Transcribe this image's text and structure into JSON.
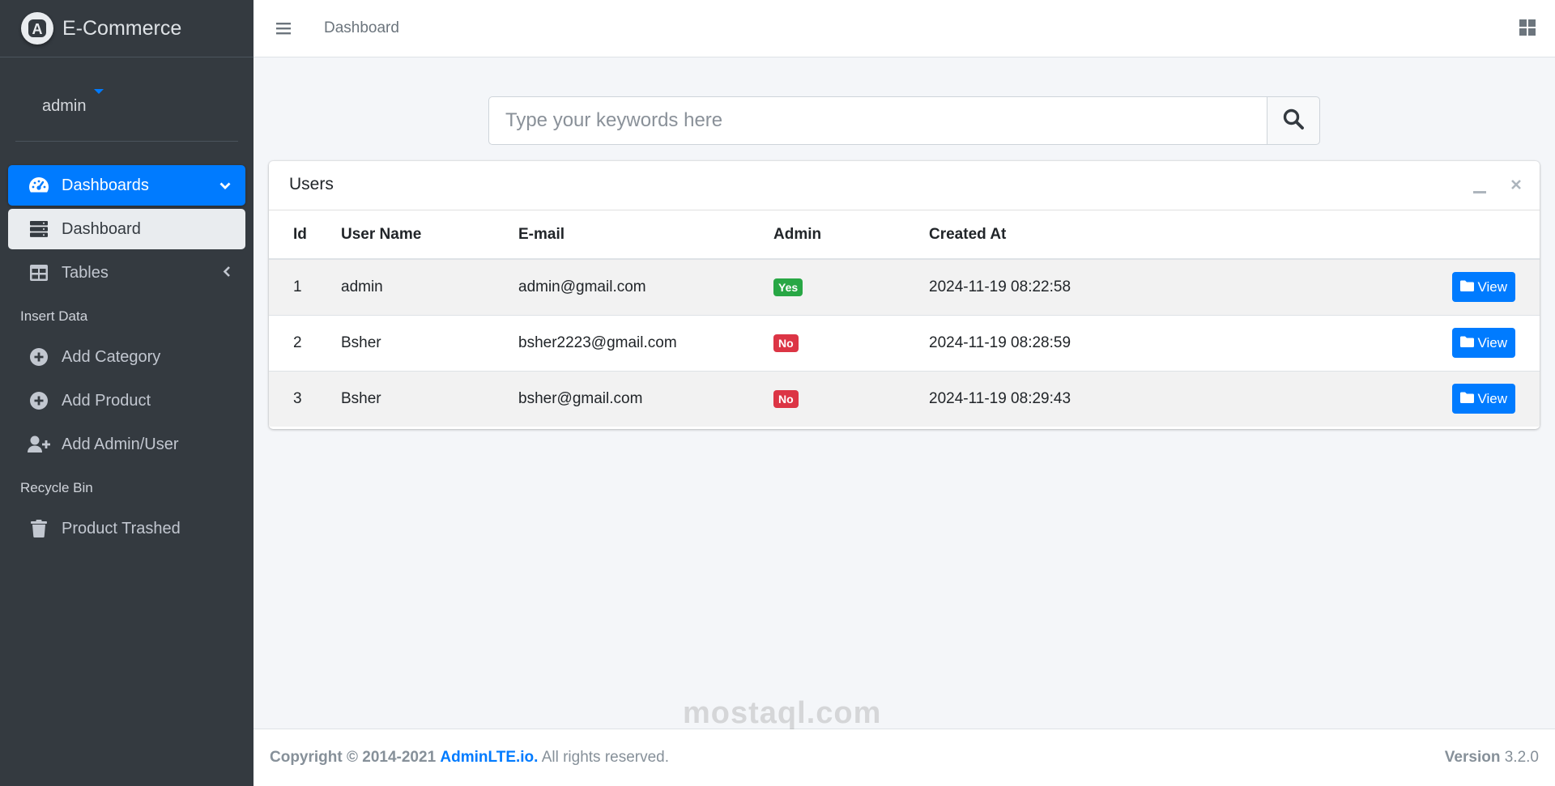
{
  "brand": {
    "name": "E-Commerce",
    "logo_letter": "A"
  },
  "user": {
    "name": "admin"
  },
  "sidebar": {
    "items": [
      {
        "label": "Dashboards",
        "icon": "tachometer-icon"
      },
      {
        "label": "Dashboard",
        "icon": "server-icon"
      },
      {
        "label": "Tables",
        "icon": "table-icon"
      }
    ],
    "header_insert": "Insert Data",
    "insert_items": [
      {
        "label": "Add Category",
        "icon": "plus-circle-icon"
      },
      {
        "label": "Add Product",
        "icon": "plus-circle-icon"
      },
      {
        "label": "Add Admin/User",
        "icon": "user-plus-icon"
      }
    ],
    "header_recycle": "Recycle Bin",
    "recycle_items": [
      {
        "label": "Product Trashed",
        "icon": "trash-icon"
      }
    ]
  },
  "topbar": {
    "link": "Dashboard"
  },
  "search": {
    "placeholder": "Type your keywords here"
  },
  "card": {
    "title": "Users",
    "columns": [
      "Id",
      "User Name",
      "E-mail",
      "Admin",
      "Created At"
    ],
    "rows": [
      {
        "id": "1",
        "name": "admin",
        "email": "admin@gmail.com",
        "admin": "Yes",
        "created": "2024-11-19 08:22:58",
        "action": "View"
      },
      {
        "id": "2",
        "name": "Bsher",
        "email": "bsher2223@gmail.com",
        "admin": "No",
        "created": "2024-11-19 08:28:59",
        "action": "View"
      },
      {
        "id": "3",
        "name": "Bsher",
        "email": "bsher@gmail.com",
        "admin": "No",
        "created": "2024-11-19 08:29:43",
        "action": "View"
      }
    ]
  },
  "footer": {
    "copyright": "Copyright © 2014-2021",
    "link": "AdminLTE.io.",
    "rights": "All rights reserved.",
    "version_label": "Version",
    "version": "3.2.0"
  },
  "watermark": "mostaql.com",
  "colors": {
    "primary": "#007bff",
    "sidebar": "#343a40",
    "success": "#28a745",
    "danger": "#dc3545"
  }
}
